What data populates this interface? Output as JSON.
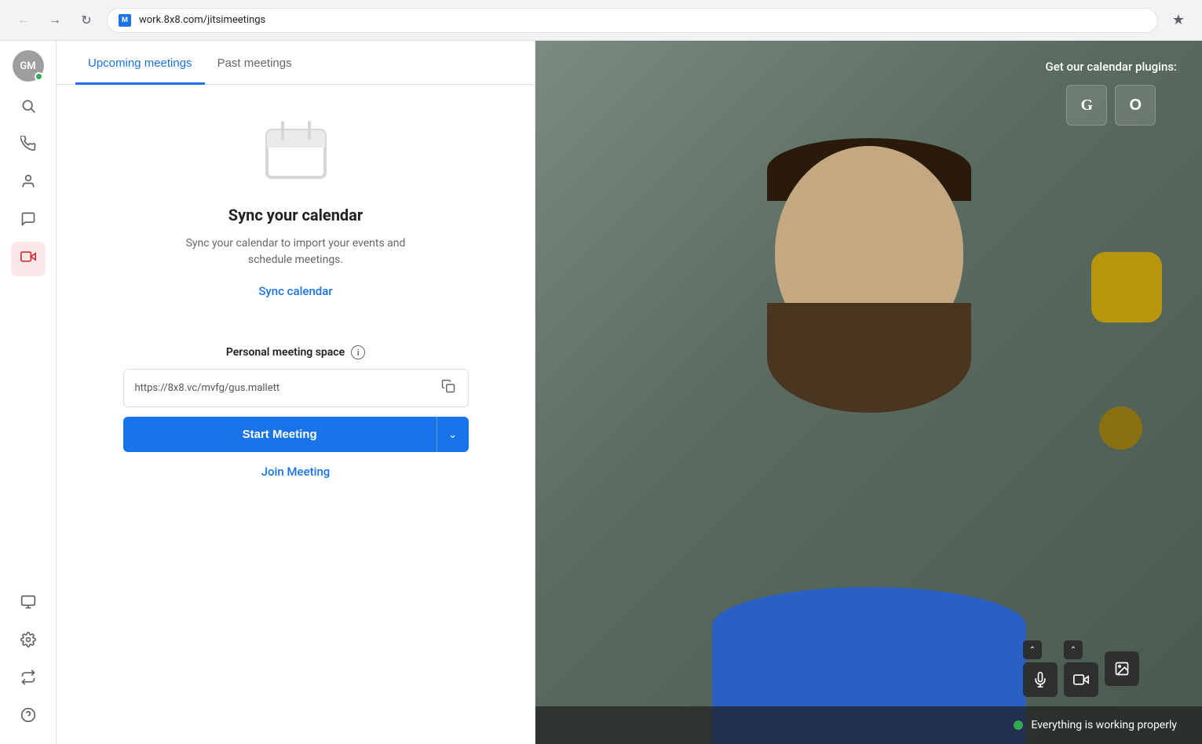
{
  "browser": {
    "url": "work.8x8.com/jitsimeetings",
    "site_icon": "M"
  },
  "sidebar": {
    "avatar_initials": "GM",
    "items": [
      {
        "name": "search",
        "icon": "🔍"
      },
      {
        "name": "phone",
        "icon": "📞"
      },
      {
        "name": "contacts",
        "icon": "👤"
      },
      {
        "name": "chat",
        "icon": "💬"
      },
      {
        "name": "video",
        "icon": "🎥",
        "active": true
      }
    ],
    "bottom_items": [
      {
        "name": "desktop",
        "icon": "🖥"
      },
      {
        "name": "settings",
        "icon": "⚙️"
      },
      {
        "name": "swap",
        "icon": "↔"
      },
      {
        "name": "help",
        "icon": "?"
      }
    ]
  },
  "tabs": {
    "upcoming": "Upcoming meetings",
    "past": "Past meetings"
  },
  "sync_section": {
    "title": "Sync your calendar",
    "description": "Sync your calendar to import your events and schedule meetings.",
    "sync_link": "Sync calendar"
  },
  "personal_meeting": {
    "label": "Personal meeting space",
    "url": "https://8x8.vc/mvfg/gus.mallett",
    "start_button": "Start Meeting",
    "join_link": "Join Meeting"
  },
  "video_panel": {
    "plugins_label": "Get our calendar plugins:",
    "google_label": "G",
    "office_label": "O",
    "status_text": "Everything is working properly"
  }
}
